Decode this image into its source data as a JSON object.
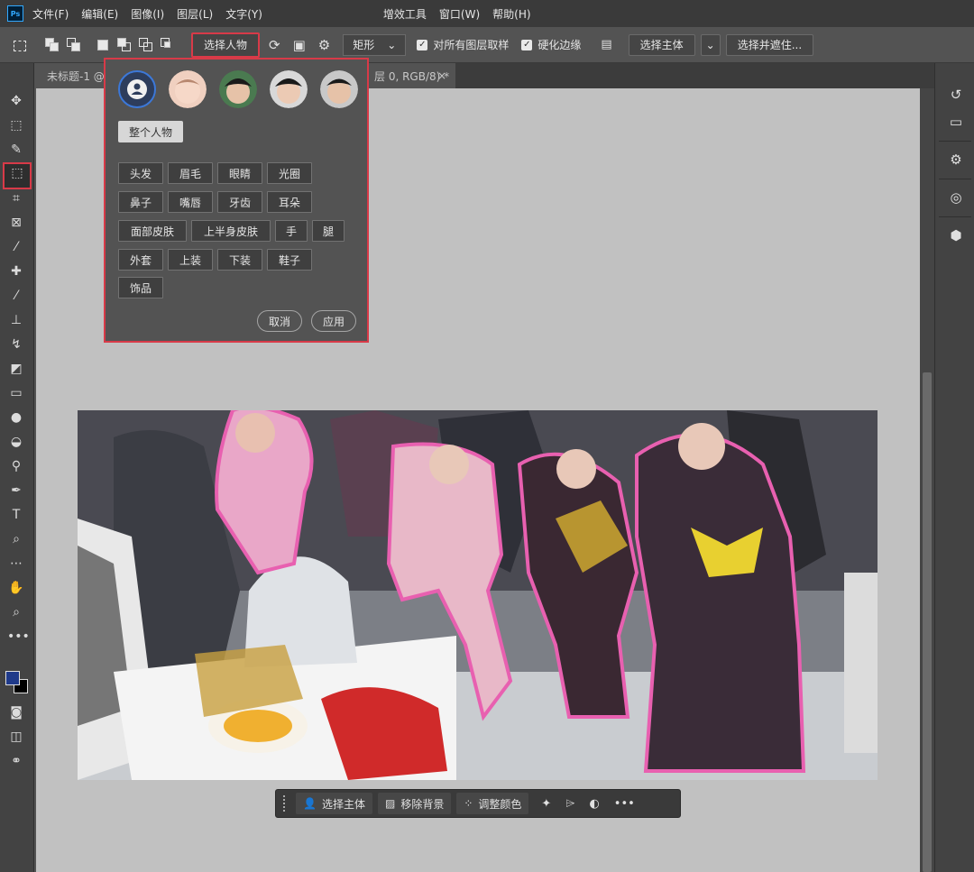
{
  "menu": {
    "items": [
      "文件(F)",
      "编辑(E)",
      "图像(I)",
      "图层(L)",
      "文字(Y)"
    ],
    "items_right": [
      "增效工具",
      "窗口(W)",
      "帮助(H)"
    ]
  },
  "options": {
    "select_person": "选择人物",
    "mode_select": "矩形",
    "sample_all_layers": "对所有图层取样",
    "harden_edge": "硬化边缘",
    "select_subject": "选择主体",
    "select_and_mask": "选择并遮住..."
  },
  "tab": {
    "title": "未标题-1 @",
    "title_tail": "层 0, RGB/8) *",
    "close": "×"
  },
  "popup": {
    "whole_person": "整个人物",
    "parts": [
      "头发",
      "眉毛",
      "眼睛",
      "光圈",
      "鼻子",
      "嘴唇",
      "牙齿",
      "耳朵",
      "面部皮肤",
      "上半身皮肤",
      "手",
      "腿",
      "外套",
      "上装",
      "下装",
      "鞋子",
      "饰品"
    ],
    "cancel": "取消",
    "apply": "应用"
  },
  "taskbar": {
    "select_subject": "选择主体",
    "remove_bg": "移除背景",
    "adjust_color": "调整颜色"
  },
  "colors": {
    "accent_red": "#d83a48",
    "foreground": "#1f3a8a",
    "background": "#000000",
    "selection_pink": "#e860b0"
  }
}
